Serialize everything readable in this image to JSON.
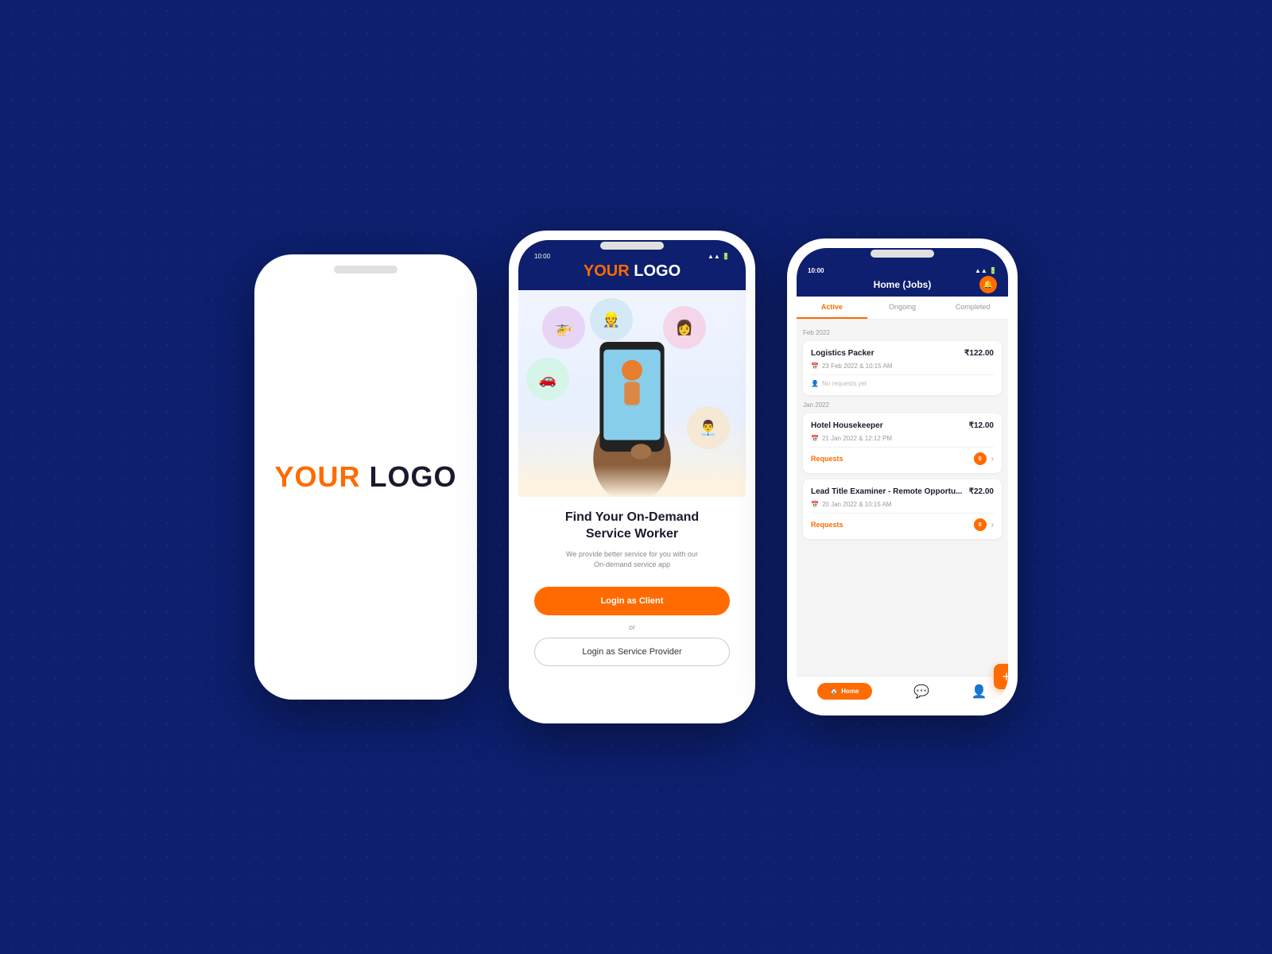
{
  "background": {
    "color": "#0d1f6e"
  },
  "phone1": {
    "logo_your": "YOUR",
    "logo_logo": "LOGO"
  },
  "phone2": {
    "status_time": "10:00",
    "header_logo_your": "YOUR",
    "header_logo_logo": "LOGO",
    "illustration_bubbles": [
      {
        "emoji": "🚁",
        "color": "#e8d5f5"
      },
      {
        "emoji": "👷",
        "color": "#d5e8f5"
      },
      {
        "emoji": "👩",
        "color": "#f5d5e8"
      },
      {
        "emoji": "🚗",
        "color": "#d5f5e8"
      },
      {
        "emoji": "👨‍💼",
        "color": "#f5e8d5"
      }
    ],
    "find_title": "Find Your On-Demand\nService Worker",
    "find_subtitle": "We provide better service for you with our\nOn-demand service app",
    "btn_client": "Login as Client",
    "or_text": "or",
    "btn_provider": "Login as Service Provider"
  },
  "phone3": {
    "status_time": "10:00",
    "title": "Home (Jobs)",
    "tabs": [
      "Active",
      "Ongoing",
      "Completed"
    ],
    "active_tab": "Active",
    "sections": [
      {
        "label": "Feb 2022",
        "jobs": [
          {
            "title": "Logistics Packer",
            "date": "23 Feb 2022 & 10:15 AM",
            "price": "₹122.00",
            "has_requests": false,
            "no_request_text": "No requests yet",
            "requests_count": null
          }
        ]
      },
      {
        "label": "Jan 2022",
        "jobs": [
          {
            "title": "Hotel Housekeeper",
            "date": "21 Jan 2022 & 12:12 PM",
            "price": "₹12.00",
            "has_requests": true,
            "requests_label": "Requests",
            "requests_count": "0"
          },
          {
            "title": "Lead Title Examiner - Remote Opportu...",
            "date": "20 Jan 2022 & 10:15 AM",
            "price": "₹22.00",
            "has_requests": true,
            "requests_label": "Requests",
            "requests_count": "0"
          }
        ]
      }
    ],
    "nav": {
      "home": "Home",
      "chat_icon": "💬",
      "profile_icon": "👤"
    },
    "fab_icon": "+"
  }
}
